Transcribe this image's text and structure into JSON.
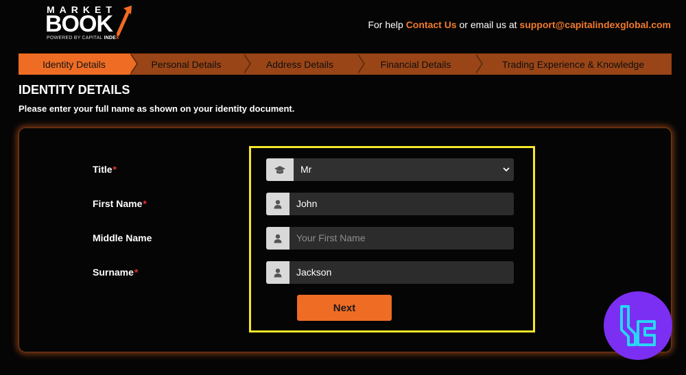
{
  "header": {
    "logo": {
      "top": "MARKET",
      "main": "BOOK",
      "sub_prefix": "POWERED BY CAPITAL",
      "sub_brand": "INDE",
      "sub_x": "X"
    },
    "help_prefix": "For help",
    "contact_label": "Contact Us",
    "help_middle": "or email us at",
    "email": "support@capitalindexglobal.com"
  },
  "steps": [
    {
      "label": "Identity Details",
      "active": true
    },
    {
      "label": "Personal Details",
      "active": false
    },
    {
      "label": "Address Details",
      "active": false
    },
    {
      "label": "Financial Details",
      "active": false
    },
    {
      "label": "Trading Experience & Knowledge",
      "active": false
    }
  ],
  "section": {
    "title": "IDENTITY DETAILS",
    "description": "Please enter your full name as shown on your identity document."
  },
  "form": {
    "title_label": "Title",
    "title_value": "Mr",
    "first_name_label": "First Name",
    "first_name_value": "John",
    "middle_name_label": "Middle Name",
    "middle_name_placeholder": "Your First Name",
    "surname_label": "Surname",
    "surname_value": "Jackson",
    "required_mark": "*",
    "next_label": "Next"
  },
  "colors": {
    "accent": "#ee6c24",
    "highlight": "#f4ea2b",
    "required": "#e8312d",
    "badge": "#7b2ff2"
  },
  "icons": {
    "title": "graduation-cap-icon",
    "person": "user-icon",
    "dropdown": "chevron-down-icon"
  }
}
